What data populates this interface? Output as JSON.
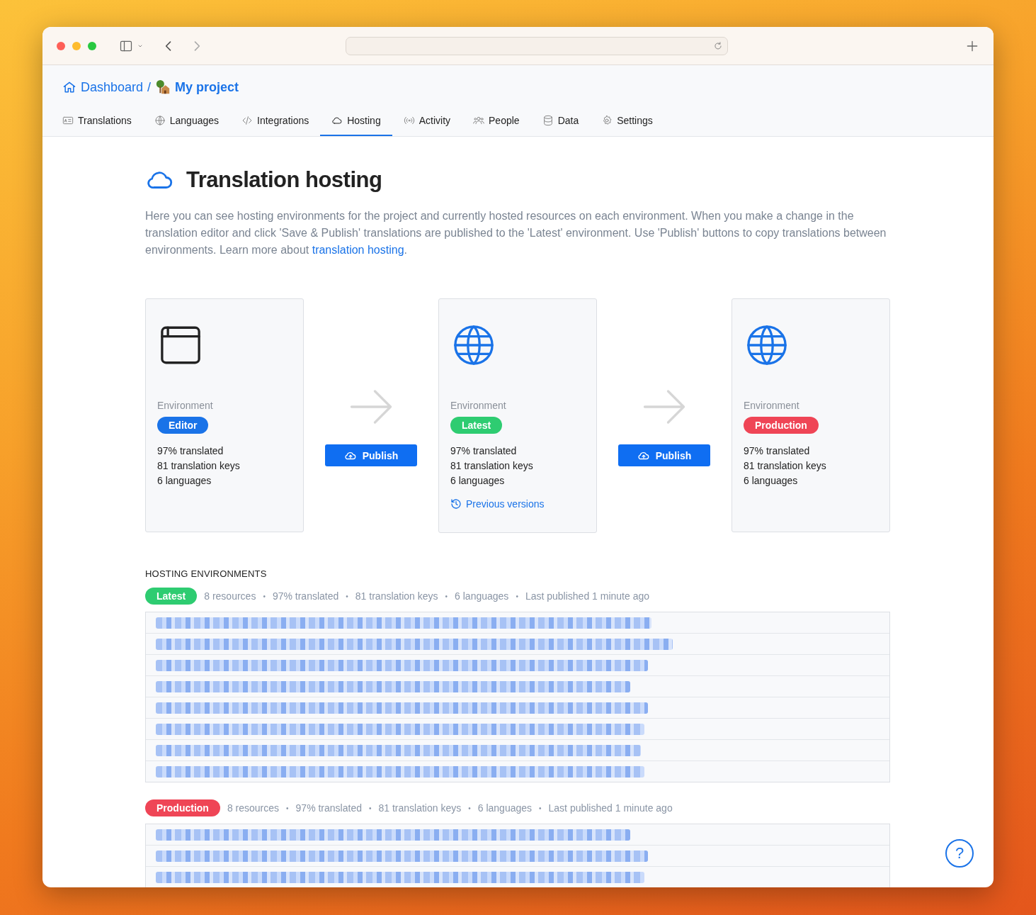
{
  "breadcrumbs": [
    {
      "label": "Dashboard",
      "kind": "home"
    },
    {
      "label": "My project",
      "kind": "project"
    }
  ],
  "breadcrumb_separator": "/",
  "tabs": [
    {
      "label": "Translations",
      "kind": "translations",
      "selected": false
    },
    {
      "label": "Languages",
      "kind": "languages",
      "selected": false
    },
    {
      "label": "Integrations",
      "kind": "integrations",
      "selected": false
    },
    {
      "label": "Hosting",
      "kind": "hosting",
      "selected": true
    },
    {
      "label": "Activity",
      "kind": "activity",
      "selected": false
    },
    {
      "label": "People",
      "kind": "people",
      "selected": false
    },
    {
      "label": "Data",
      "kind": "data",
      "selected": false
    },
    {
      "label": "Settings",
      "kind": "settings",
      "selected": false
    }
  ],
  "heading": "Translation hosting",
  "intro": {
    "text": "Here you can see hosting environments for the project and currently hosted resources on each environment. When you make a change in the translation editor and click 'Save & Publish' translations are published to the 'Latest' environment. Use 'Publish' buttons to copy translations between environments. Learn more about ",
    "link": "translation hosting",
    "end": "."
  },
  "environments": [
    {
      "kind": "editor",
      "label": "Environment",
      "badge": "Editor",
      "color": "#1a73e8",
      "stats": [
        "97% translated",
        "81 translation keys",
        "6 languages"
      ]
    },
    {
      "kind": "hosted",
      "label": "Environment",
      "badge": "Latest",
      "color": "#2ecc71",
      "stats": [
        "97% translated",
        "81 translation keys",
        "6 languages"
      ],
      "link": "Previous versions"
    },
    {
      "kind": "hosted",
      "label": "Environment",
      "badge": "Production",
      "color": "#ef4556",
      "stats": [
        "97% translated",
        "81 translation keys",
        "6 languages"
      ]
    }
  ],
  "publish_buttons": [
    "Publish",
    "Publish"
  ],
  "section_title": "HOSTING ENVIRONMENTS",
  "hosting_environments": [
    {
      "badge": "Latest",
      "color": "#2ecc71",
      "separator": "•",
      "stats": [
        "8 resources",
        "97% translated",
        "81 translation keys",
        "6 languages",
        "Last published 1 minute ago"
      ],
      "resources": [
        {
          "kind": "blurred"
        },
        {
          "kind": "blurred"
        },
        {
          "kind": "blurred"
        },
        {
          "kind": "blurred"
        },
        {
          "kind": "blurred"
        },
        {
          "kind": "blurred"
        },
        {
          "kind": "blurred"
        },
        {
          "kind": "blurred"
        }
      ]
    },
    {
      "badge": "Production",
      "color": "#ef4556",
      "separator": "•",
      "stats": [
        "8 resources",
        "97% translated",
        "81 translation keys",
        "6 languages",
        "Last published 1 minute ago"
      ],
      "resources": [
        {
          "kind": "blurred"
        },
        {
          "kind": "blurred"
        },
        {
          "kind": "blurred"
        }
      ]
    }
  ],
  "help_button": "?"
}
